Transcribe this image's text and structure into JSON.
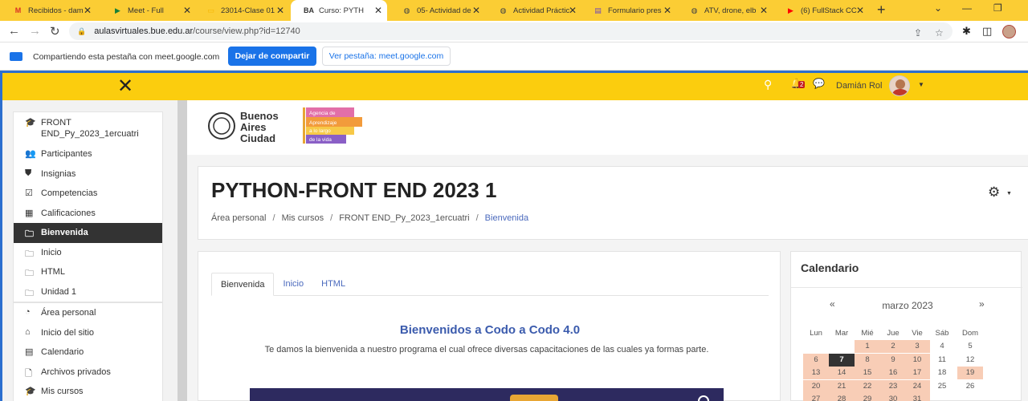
{
  "browser": {
    "tabs": [
      {
        "label": "Recibidos - dam",
        "icon": "gmail-icon",
        "color": "#d93025"
      },
      {
        "label": "Meet - Full",
        "icon": "meet-icon",
        "color": "#188038"
      },
      {
        "label": "23014-Clase 01",
        "icon": "slides-icon",
        "color": "#f4b400"
      },
      {
        "label": "Curso: PYTH",
        "icon": "ba-icon",
        "color": "#333333",
        "active": true
      },
      {
        "label": "05- Actividad de",
        "icon": "globe-icon",
        "color": "#444444"
      },
      {
        "label": "Actividad Práctic",
        "icon": "globe-icon",
        "color": "#444444"
      },
      {
        "label": "Formulario pres",
        "icon": "forms-icon",
        "color": "#7248b9"
      },
      {
        "label": "ATV, drone, elb",
        "icon": "globe-icon",
        "color": "#444444"
      },
      {
        "label": "(6) FullStack CC",
        "icon": "youtube-icon",
        "color": "#ff0000"
      }
    ],
    "url_prefix": "aulasvirtuales.bue.edu.ar",
    "url_rest": "/course/view.php?id=12740"
  },
  "sharebar": {
    "text": "Compartiendo esta pestaña con meet.google.com",
    "stop_label": "Dejar de compartir",
    "view_label": "Ver pestaña: meet.google.com"
  },
  "header": {
    "user_name": "Damián Rol",
    "notif_count": "2",
    "accent": "#fbcd0e"
  },
  "logo": {
    "line1": "Buenos",
    "line2": "Aires",
    "line3": "Ciudad",
    "agency1": "Agencia de",
    "agency2": "Aprendizaje",
    "agency3": "a lo largo",
    "agency4": "de la vida"
  },
  "sidebar": {
    "course": "FRONT END_Py_2023_1ercuatri",
    "items": [
      {
        "label": "Participantes",
        "icon": "users-icon",
        "glyph": "👥"
      },
      {
        "label": "Insignias",
        "icon": "shield-icon",
        "glyph": "⛊"
      },
      {
        "label": "Competencias",
        "icon": "checkbox-icon",
        "glyph": "☑"
      },
      {
        "label": "Calificaciones",
        "icon": "table-icon",
        "glyph": "▦"
      },
      {
        "label": "Bienvenida",
        "icon": "folder-icon",
        "glyph": "🗀",
        "active": true
      },
      {
        "label": "Inicio",
        "icon": "folder-icon",
        "glyph": "🗀"
      },
      {
        "label": "HTML",
        "icon": "folder-icon",
        "glyph": "🗀"
      },
      {
        "label": "Unidad 1",
        "icon": "folder-icon",
        "glyph": "🗀"
      }
    ],
    "items2": [
      {
        "label": "Área personal",
        "icon": "dashboard-icon",
        "glyph": "◔"
      },
      {
        "label": "Inicio del sitio",
        "icon": "home-icon",
        "glyph": "⌂"
      },
      {
        "label": "Calendario",
        "icon": "calendar-icon",
        "glyph": "▤"
      },
      {
        "label": "Archivos privados",
        "icon": "file-icon",
        "glyph": "🗋"
      },
      {
        "label": "Mis cursos",
        "icon": "graduation-icon",
        "glyph": "🎓"
      }
    ]
  },
  "page": {
    "title": "PYTHON-FRONT END 2023 1",
    "breadcrumb": [
      "Área personal",
      "Mis cursos",
      "FRONT END_Py_2023_1ercuatri",
      "Bienvenida"
    ]
  },
  "main": {
    "tabs": [
      "Bienvenida",
      "Inicio",
      "HTML"
    ],
    "welcome_title": "Bienvenidos a Codo a Codo 4.0",
    "welcome_text": "Te damos la bienvenida a nuestro programa el cual ofrece diversas capacitaciones de las cuales ya formas parte."
  },
  "calendar": {
    "title": "Calendario",
    "month": "marzo 2023",
    "prev": "«",
    "next": "»",
    "weekdays": [
      "Lun",
      "Mar",
      "Mié",
      "Jue",
      "Vie",
      "Sáb",
      "Dom"
    ],
    "weeks": [
      [
        "",
        "",
        "1",
        "2",
        "3",
        "4",
        "5"
      ],
      [
        "6",
        "7",
        "8",
        "9",
        "10",
        "11",
        "12"
      ],
      [
        "13",
        "14",
        "15",
        "16",
        "17",
        "18",
        "19"
      ],
      [
        "20",
        "21",
        "22",
        "23",
        "24",
        "25",
        "26"
      ],
      [
        "27",
        "28",
        "29",
        "30",
        "31",
        "",
        ""
      ]
    ],
    "today": "7",
    "event_days": [
      "1",
      "2",
      "3",
      "6",
      "8",
      "9",
      "10",
      "13",
      "14",
      "15",
      "16",
      "17",
      "19",
      "20",
      "21",
      "22",
      "23",
      "24",
      "27",
      "28",
      "29",
      "30",
      "31"
    ]
  }
}
